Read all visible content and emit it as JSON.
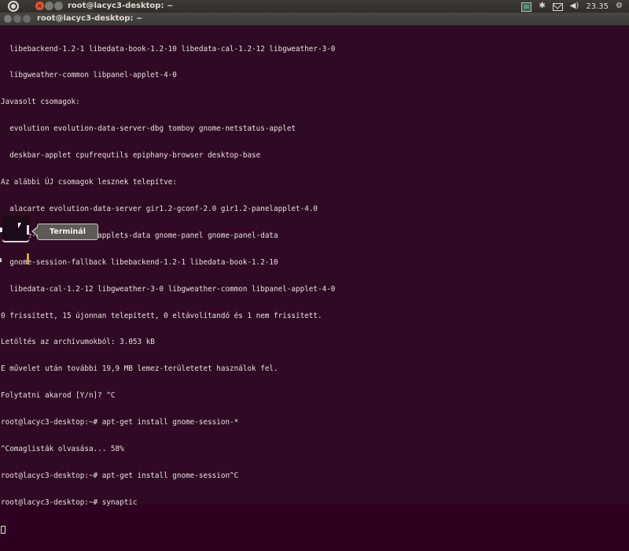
{
  "top_panel": {
    "window_title": "root@lacyc3-desktop: ~",
    "clock": "23.35"
  },
  "window": {
    "title": "root@lacyc3-desktop: ~"
  },
  "terminal": {
    "lines": [
      "  libebackend-1.2-1 libedata-book-1.2-10 libedata-cal-1.2-12 libgweather-3-0",
      "  libgweather-common libpanel-applet-4-0",
      "Javasolt csomagok:",
      "  evolution evolution-data-server-dbg tomboy gnome-netstatus-applet",
      "  deskbar-applet cpufrequtils epiphany-browser desktop-base",
      "Az alábbi ÚJ csomagok lesznek telepítve:",
      "  alacarte evolution-data-server gir1.2-gconf-2.0 gir1.2-panelapplet-4.0",
      "  gnome-applets gnome-applets-data gnome-panel gnome-panel-data",
      "  gnome-session-fallback libebackend-1.2-1 libedata-book-1.2-10",
      "  libedata-cal-1.2-12 libgweather-3-0 libgweather-common libpanel-applet-4-0",
      "0 frissített, 15 újonnan telepített, 0 eltávolítandó és 1 nem frissített.",
      "Letöltés az archívumokból: 3.053 kB",
      "E művelet után további 19,9 MB lemez-területetet használok fel.",
      "Folytatni akarod [Y/n]? ^C",
      "root@lacyc3-desktop:~# apt-get install gnome-session-*",
      "^Comaglisták olvasása... 58%",
      "root@lacyc3-desktop:~# apt-get install gnome-session^C",
      "root@lacyc3-desktop:~# synaptic"
    ]
  },
  "tooltip": {
    "label": "Terminál"
  },
  "colors": {
    "terminal_bg": "#300a24",
    "panel_bg": "#3c3b37",
    "close_accent": "#e9542f"
  }
}
